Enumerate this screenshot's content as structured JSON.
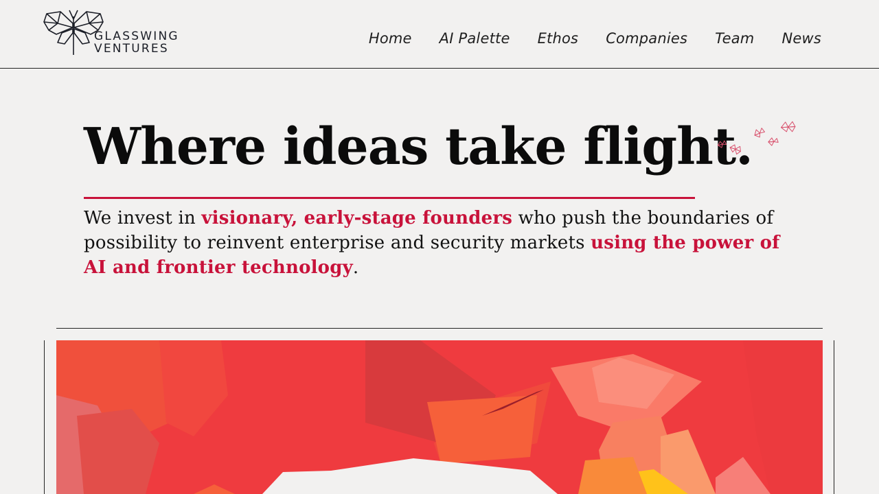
{
  "brand": {
    "logo_icon": "glasswing-butterfly-icon",
    "line1": "GLASSWING",
    "line2": "VENTURES"
  },
  "nav": {
    "items": [
      "Home",
      "AI Palette",
      "Ethos",
      "Companies",
      "Team",
      "News"
    ]
  },
  "hero": {
    "title": "Where ideas take flight.",
    "decoration_icon": "butterflies-icon",
    "lead": {
      "p1": "We invest in ",
      "h1": "visionary, early-stage founders",
      "p2": " who push the boundaries of possibility to reinvent enterprise and security markets ",
      "h2": "using the power of AI and frontier technology",
      "p3": "."
    }
  },
  "colors": {
    "accent": "#c8123a",
    "background": "#f2f1f0",
    "text": "#111111",
    "art_red": "#ef3b3f",
    "art_orange": "#f6603a",
    "art_yellow": "#ffc21a"
  }
}
